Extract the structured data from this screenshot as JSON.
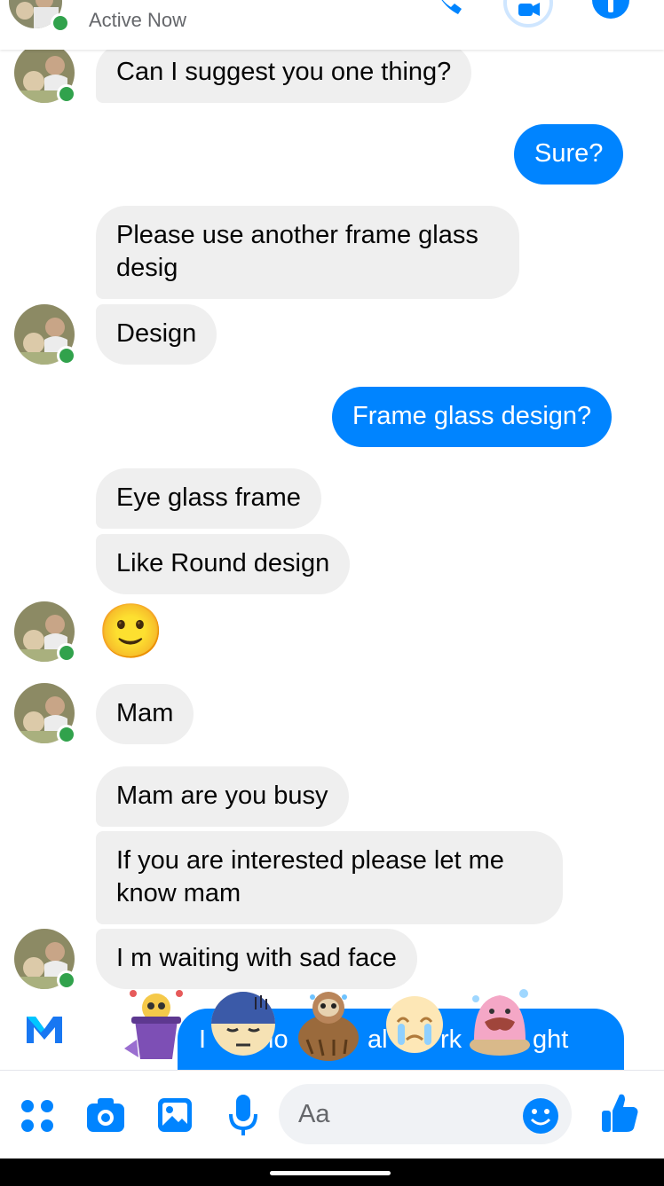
{
  "header": {
    "status": "Active Now",
    "icons": [
      "phone-icon",
      "video-icon",
      "info-icon"
    ]
  },
  "messages": [
    {
      "dir": "in",
      "text": "Can I suggest you one thing?"
    },
    {
      "dir": "out",
      "text": "Sure?"
    },
    {
      "dir": "in",
      "text": "Please use another frame glass desig"
    },
    {
      "dir": "in",
      "text": "Design"
    },
    {
      "dir": "out",
      "text": "Frame glass design?"
    },
    {
      "dir": "in",
      "text": "Eye glass frame"
    },
    {
      "dir": "in",
      "text": "Like Round design"
    },
    {
      "dir": "in",
      "emoji": "🙂"
    },
    {
      "dir": "in",
      "text": "Mam"
    },
    {
      "dir": "in",
      "text": "Mam are you busy"
    },
    {
      "dir": "in",
      "text": "If you are interested please let me know mam"
    },
    {
      "dir": "in",
      "text": "I m waiting with sad face"
    }
  ],
  "partial_outgoing": {
    "fragments": [
      "I",
      "lo",
      "al",
      "rk",
      "ght"
    ]
  },
  "sticker_suggestions": [
    "trash-bin-sticker",
    "sad-face-sticker",
    "sloth-crying-sticker",
    "crying-face-sticker",
    "melting-cake-sticker"
  ],
  "composer": {
    "placeholder": "Aa",
    "icons": [
      "menu-dots-icon",
      "camera-icon",
      "gallery-icon",
      "microphone-icon",
      "emoji-icon",
      "thumbs-up-icon"
    ]
  },
  "colors": {
    "accent": "#0084ff",
    "incoming_bubble": "#efefef",
    "online": "#31a24c"
  }
}
